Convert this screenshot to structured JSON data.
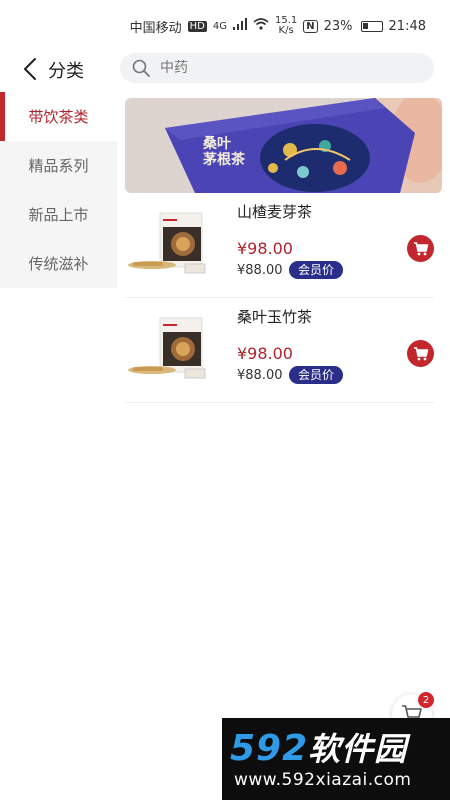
{
  "status": {
    "carrier": "中国移动",
    "hd": "HD",
    "net": "4G",
    "speed_value": "15.1",
    "speed_unit": "K/s",
    "nfc": "N",
    "battery": "23%",
    "time": "21:48"
  },
  "header": {
    "title": "分类",
    "search_placeholder": "中药"
  },
  "sidebar": {
    "items": [
      {
        "label": "带饮茶类",
        "active": true
      },
      {
        "label": "精品系列"
      },
      {
        "label": "新品上市"
      },
      {
        "label": "传统滋补"
      }
    ]
  },
  "banner": {
    "text_line1": "桑叶",
    "text_line2": "茅根茶"
  },
  "products": [
    {
      "name": "山楂麦芽茶",
      "price": "¥98.00",
      "member_price": "¥88.00",
      "member_label": "会员价"
    },
    {
      "name": "桑叶玉竹茶",
      "price": "¥98.00",
      "member_price": "¥88.00",
      "member_label": "会员价"
    }
  ],
  "cart": {
    "count": "2"
  },
  "watermark": {
    "num": "592",
    "cn": "软件园",
    "url": "www.592xiazai.com"
  },
  "colors": {
    "accent": "#c1272d",
    "member_badge": "#2a2d8a"
  }
}
